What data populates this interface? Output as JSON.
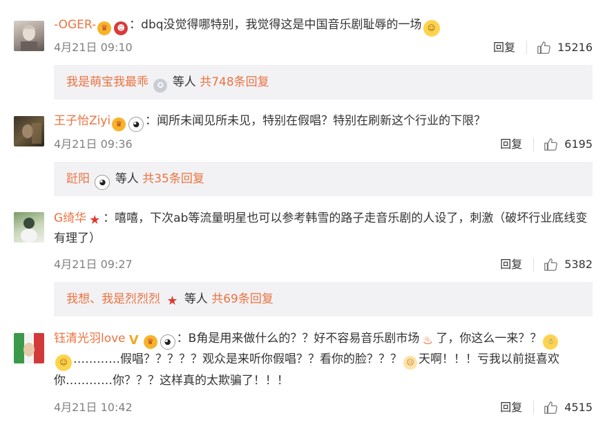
{
  "comments": [
    {
      "username": "-OGER-",
      "text": "：dbq没觉得哪特别，我觉得这是中国音乐剧耻辱的一场",
      "time": "4月21日 09:10",
      "reply_label": "回复",
      "likes": "15216",
      "sub": {
        "names": "我是萌宝我最乖",
        "suffix": "等人",
        "total": "共748条回复"
      }
    },
    {
      "username": "王子怡Ziyi",
      "text": "：闻所未闻见所未见，特别在假唱？特别在刷新这个行业的下限？",
      "time": "4月21日 09:36",
      "reply_label": "回复",
      "likes": "6195",
      "sub": {
        "names": "跹阳",
        "suffix": "等人",
        "total": "共35条回复"
      }
    },
    {
      "username": "G绮华",
      "text": "：嘻嘻，下次ab等流量明星也可以参考韩雪的路子走音乐剧的人设了，刺激（破坏行业底线变有理了）",
      "time": "4月21日 09:27",
      "reply_label": "回复",
      "likes": "5382",
      "sub": {
        "names": "我想、我是烈烈烈",
        "suffix": "等人",
        "total": "共69条回复"
      }
    },
    {
      "username": "钰清光羽love",
      "text_a": "：B角是用来做什么的？？好不容易音乐剧市场",
      "text_b": "了，你这么一来？？",
      "text_c": "…………假唱？？？？？观众是来听你假唱？？看你的脸？？？",
      "text_d": "天啊！！！亏我以前挺喜欢你…………你？？？这样真的太欺骗了！！！",
      "time": "4月21日 10:42",
      "reply_label": "回复",
      "likes": "4515"
    }
  ],
  "colors": {
    "username": "#eb7340",
    "meta": "#808080",
    "subbg": "#f2f2f5"
  }
}
